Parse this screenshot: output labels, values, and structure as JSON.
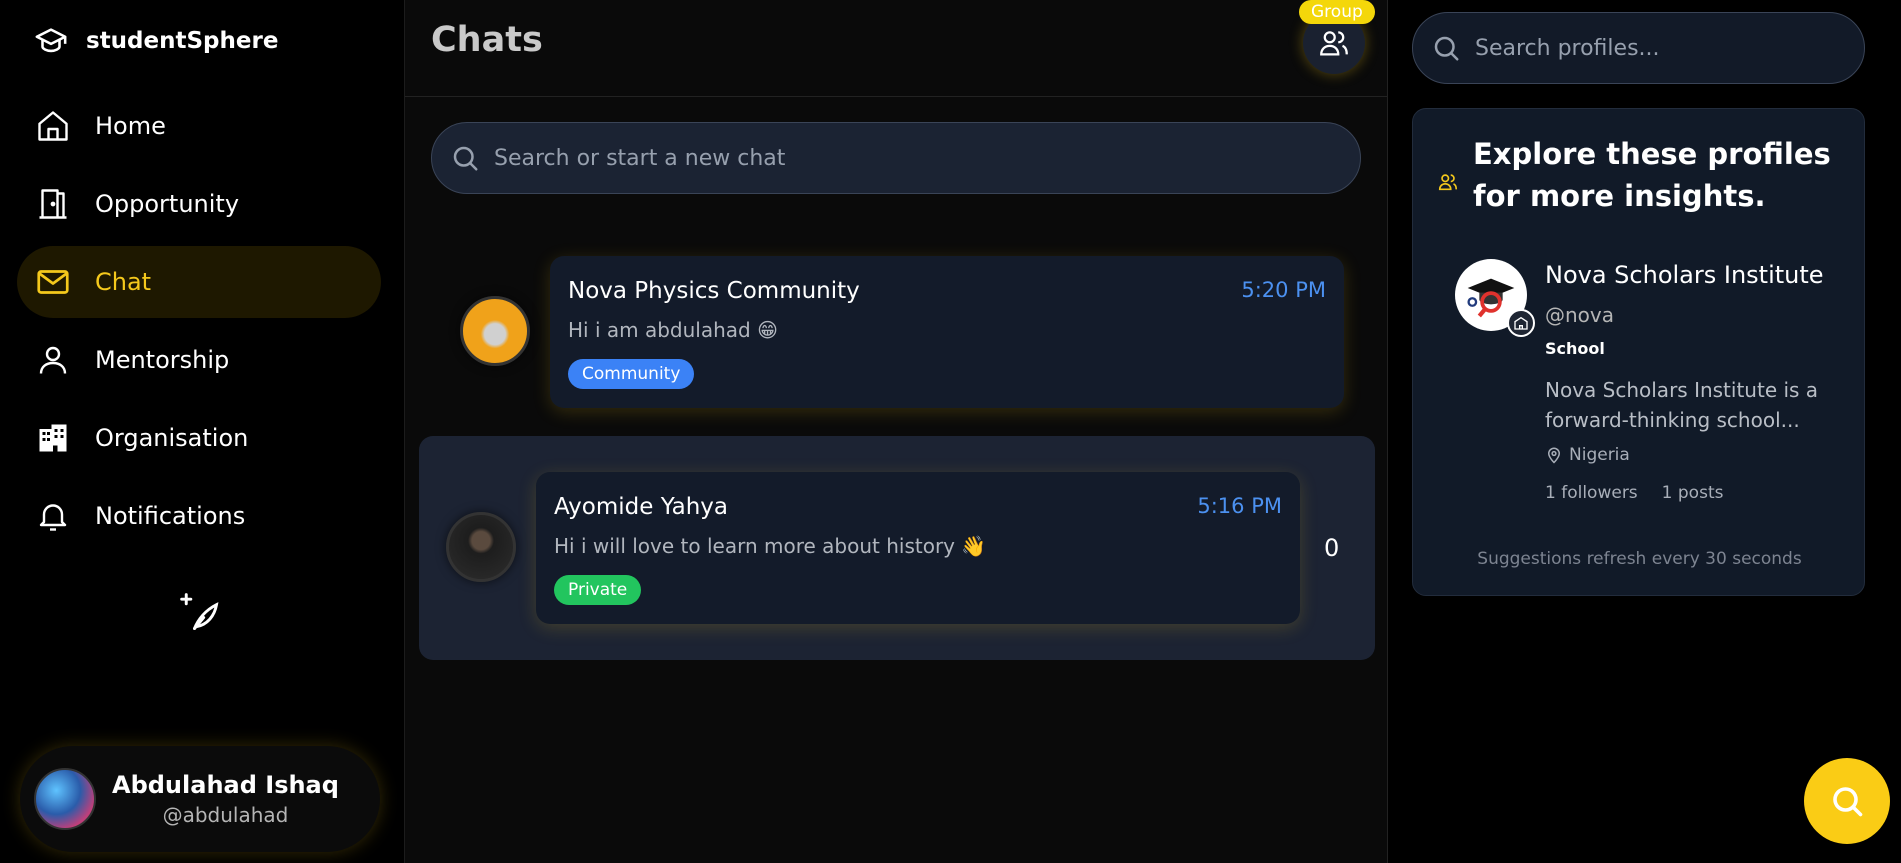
{
  "brand": {
    "name": "studentSphere"
  },
  "sidebar": {
    "items": [
      {
        "label": "Home",
        "icon": "home-icon",
        "active": false
      },
      {
        "label": "Opportunity",
        "icon": "door-icon",
        "active": false
      },
      {
        "label": "Chat",
        "icon": "mail-icon",
        "active": true
      },
      {
        "label": "Mentorship",
        "icon": "user-icon",
        "active": false
      },
      {
        "label": "Organisation",
        "icon": "building-icon",
        "active": false
      },
      {
        "label": "Notifications",
        "icon": "bell-icon",
        "active": false
      }
    ],
    "compose_icon": "feather-plus-icon"
  },
  "user": {
    "name": "Abdulahad Ishaq",
    "handle": "@abdulahad"
  },
  "chats": {
    "title": "Chats",
    "group_badge": "Group",
    "search_placeholder": "Search or start a new chat",
    "list": [
      {
        "name": "Nova Physics Community",
        "time": "5:20 PM",
        "message": "Hi i am abdulahad 😁",
        "tag": "Community",
        "unread": ""
      },
      {
        "name": "Ayomide Yahya",
        "time": "5:16 PM",
        "message": "Hi i will love to learn more about history 👋",
        "tag": "Private",
        "unread": "0"
      }
    ]
  },
  "right_panel": {
    "search_placeholder": "Search profiles...",
    "explore_title": "Explore these profiles for more insights.",
    "suggestion": {
      "name": "Nova Scholars Institute",
      "handle": "@nova",
      "type": "School",
      "description": "Nova Scholars Institute is a forward-thinking school...",
      "location": "Nigeria",
      "followers": "1 followers",
      "posts": "1 posts"
    },
    "footer": "Suggestions refresh every 30 seconds"
  },
  "colors": {
    "accent": "#f4c81c",
    "link": "#4c91f0",
    "community_tag": "#3b82f6",
    "private_tag": "#22c55e"
  }
}
